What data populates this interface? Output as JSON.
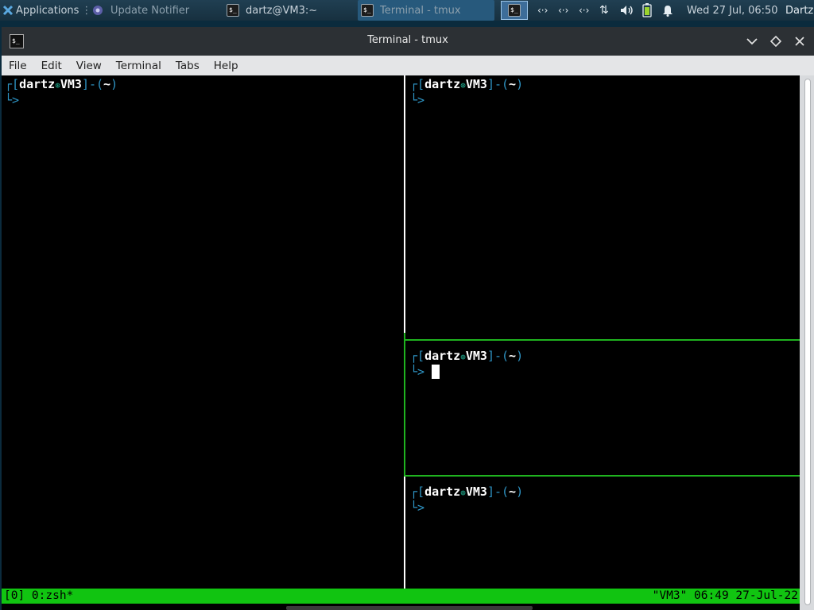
{
  "panel": {
    "applications_label": "Applications",
    "tasks": [
      {
        "label": "Update Notifier",
        "icon": "update-notifier-icon"
      },
      {
        "label": "dartz@VM3:~",
        "icon": "terminal-icon"
      },
      {
        "label": "Terminal - tmux",
        "icon": "terminal-icon"
      }
    ],
    "clock": "Wed 27 Jul, 06:50",
    "user": "Dartz"
  },
  "window": {
    "title": "Terminal - tmux",
    "menu": [
      "File",
      "Edit",
      "View",
      "Terminal",
      "Tabs",
      "Help"
    ]
  },
  "prompt": {
    "user": "dartz",
    "at_symbol": "⊛",
    "host": "VM3",
    "dir": "~",
    "arrow": ">"
  },
  "status": {
    "left": "[0] 0:zsh*",
    "right": "\"VM3\" 06:49 27-Jul-22"
  },
  "colors": {
    "status_bg": "#11c411",
    "active_border": "#1fb31f",
    "prompt_accent": "#2e94c4",
    "terminal_bg": "#000000"
  }
}
